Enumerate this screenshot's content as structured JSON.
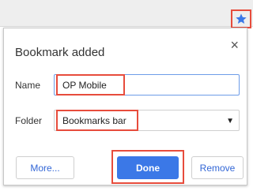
{
  "window": {
    "bookmark_star": "star-icon"
  },
  "dialog": {
    "title": "Bookmark added",
    "close": "×",
    "name_label": "Name",
    "name_value": "OP Mobile",
    "folder_label": "Folder",
    "folder_value": "Bookmarks bar",
    "more_label": "More...",
    "done_label": "Done",
    "remove_label": "Remove"
  },
  "colors": {
    "accent": "#3b78e7",
    "highlight": "#e74c3c",
    "link": "#3367d6"
  }
}
